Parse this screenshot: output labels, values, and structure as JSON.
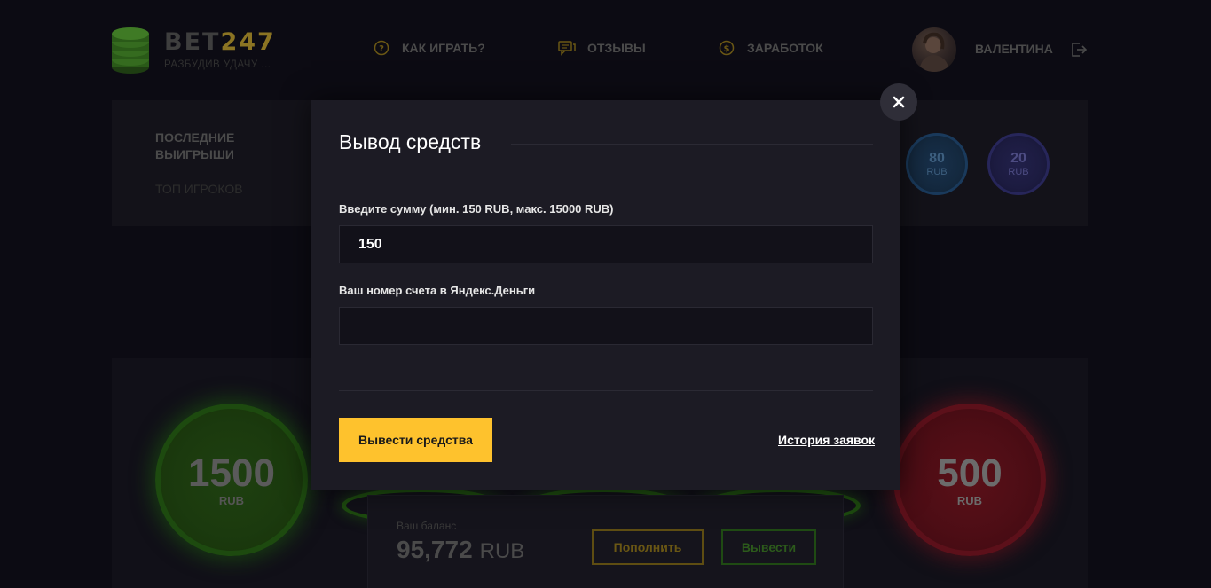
{
  "header": {
    "logo": {
      "brand_main": "BET",
      "brand_accent": "247",
      "tagline": "РАЗБУДИВ УДАЧУ ..."
    },
    "nav": [
      {
        "label": "КАК ИГРАТЬ?",
        "icon": "question-circle-icon"
      },
      {
        "label": "ОТЗЫВЫ",
        "icon": "chat-bubbles-icon"
      },
      {
        "label": "ЗАРАБОТОК",
        "icon": "dollar-circle-icon"
      }
    ],
    "user": {
      "name": "ВАЛЕНТИНА",
      "avatar_icon": "avatar",
      "logout_icon": "logout-icon"
    }
  },
  "sidebar": {
    "tabs": [
      {
        "label_line1": "ПОСЛЕДНИЕ",
        "label_line2": "ВЫИГРЫШИ"
      },
      {
        "label": "ТОП ИГРОКОВ"
      }
    ]
  },
  "recent_wins": [
    {
      "value": "80",
      "currency": "RUB",
      "color": "#1a3a5c"
    },
    {
      "value": "20",
      "currency": "RUB",
      "color": "#27265a"
    }
  ],
  "bet_chips": [
    {
      "value": "1500",
      "currency": "RUB",
      "color": "#1d4a0f"
    },
    {
      "value": "500",
      "currency": "RUB",
      "color": "#5c101a"
    }
  ],
  "balance": {
    "label": "Ваш баланс",
    "amount": "95,772",
    "currency": "RUB",
    "topup_label": "Пополнить",
    "withdraw_label": "Вывести"
  },
  "modal": {
    "title": "Вывод средств",
    "amount_label": "Введите сумму (мин. 150 RUB, макс. 15000 RUB)",
    "amount_value": "150",
    "account_label": "Ваш номер счета в Яндекс.Деньги",
    "account_value": "",
    "submit_label": "Вывести средства",
    "history_label": "История заявок",
    "close_icon": "close-icon"
  },
  "colors": {
    "accent_yellow": "#fec22d",
    "modal_bg": "#1c1b24",
    "page_bg": "#0c0b13"
  }
}
